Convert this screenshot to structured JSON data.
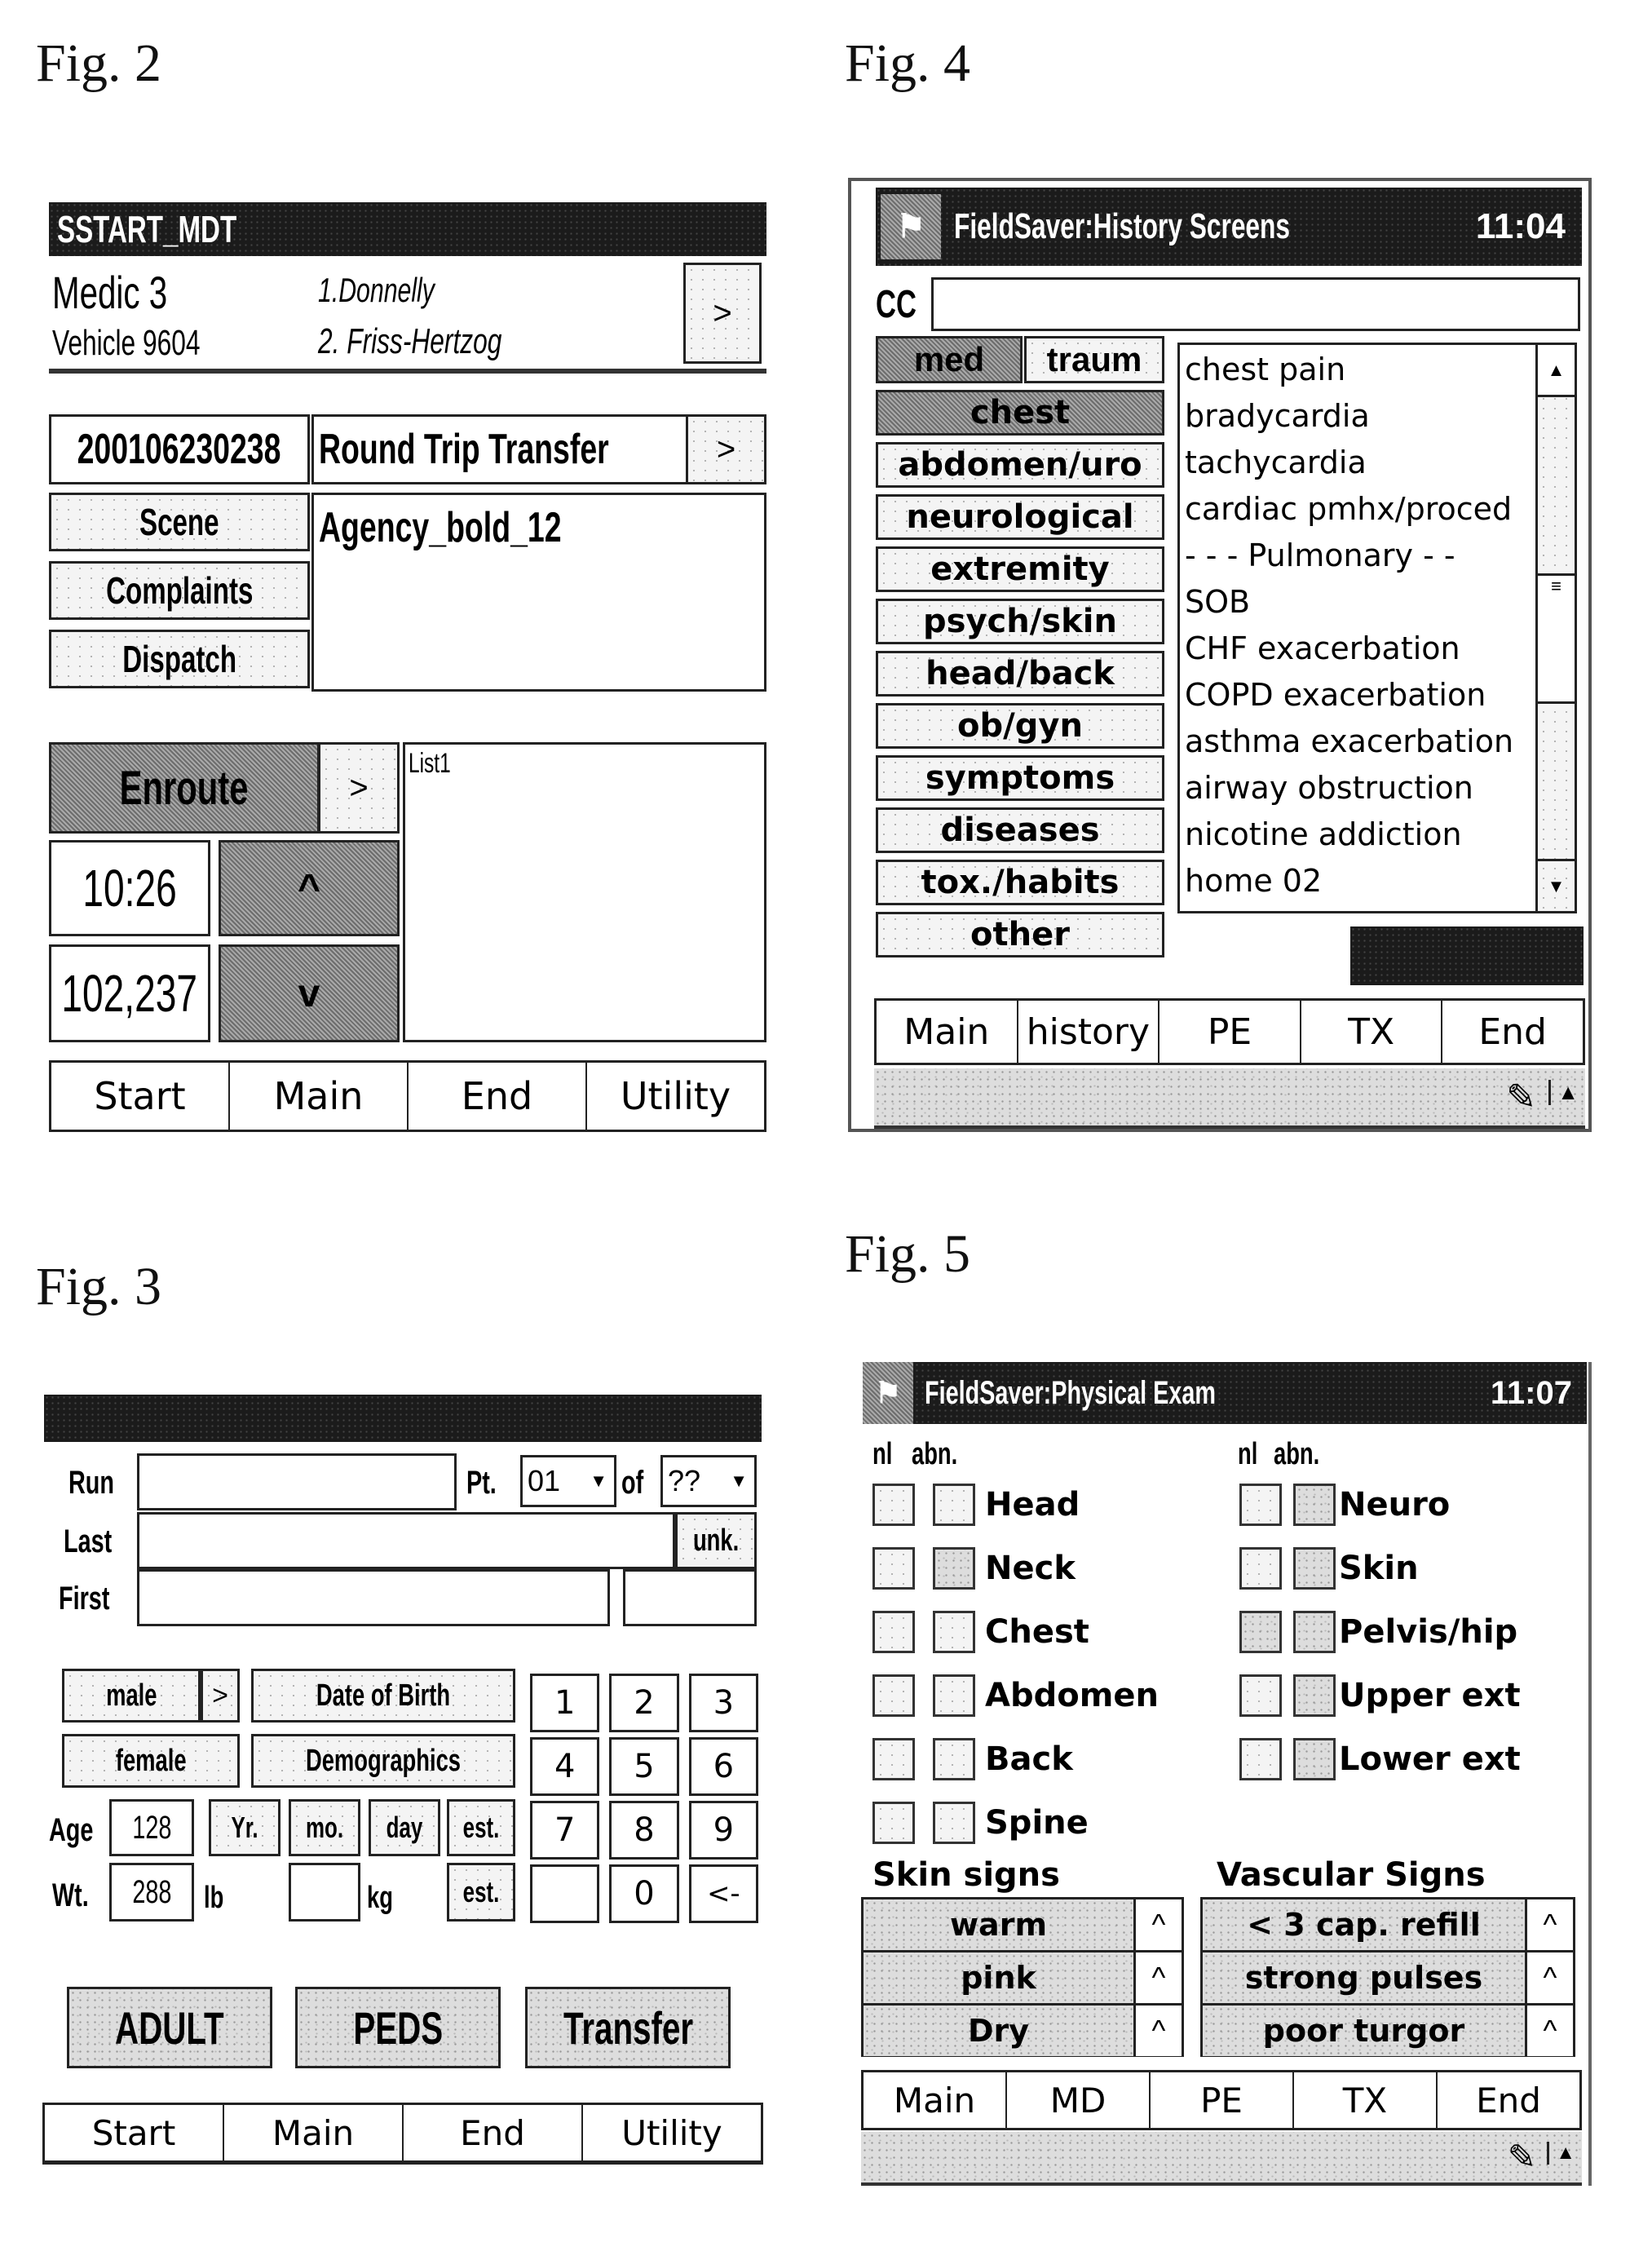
{
  "figures": {
    "fig2": {
      "label": "Fig. 2",
      "title": "SSTART_MDT",
      "unit": "Medic 3",
      "vehicle": "Vehicle 9604",
      "crew1": "1.Donnelly",
      "crew2": "2. Friss-Hertzog",
      "crew_next": ">",
      "run_number": "200106230238",
      "call_type": "Round Trip Transfer",
      "call_type_next": ">",
      "buttons": [
        "Scene",
        "Complaints",
        "Dispatch"
      ],
      "agency_text": "Agency_bold_12",
      "status_button": "Enroute",
      "status_next": ">",
      "time": "10:26",
      "odometer": "102,237",
      "up": "^",
      "down": "v",
      "list_label": "List1",
      "tabs": [
        "Start",
        "Main",
        "End",
        "Utility"
      ]
    },
    "fig3": {
      "label": "Fig. 3",
      "run_label": "Run",
      "run_value": "",
      "pt_label": "Pt.",
      "pt_value": "01",
      "of_label": "of",
      "of_value": "??",
      "last_label": "Last",
      "last_value": "",
      "unk_button": "unk.",
      "first_label": "First",
      "first_value": "",
      "male": "male",
      "male_next": ">",
      "female": "female",
      "dob": "Date of Birth",
      "demographics": "Demographics",
      "age_label": "Age",
      "age_value": "128",
      "age_units": [
        "Yr.",
        "mo.",
        "day",
        "est."
      ],
      "wt_label": "Wt.",
      "wt_value": "288",
      "lb": "lb",
      "kg_value": "",
      "kg": "kg",
      "wt_est": "est.",
      "keypad": [
        "1",
        "2",
        "3",
        "4",
        "5",
        "6",
        "7",
        "8",
        "9",
        "",
        "0",
        "<-"
      ],
      "category_buttons": [
        "ADULT",
        "PEDS",
        "Transfer"
      ],
      "tabs": [
        "Start",
        "Main",
        "End",
        "Utility"
      ]
    },
    "fig4": {
      "label": "Fig. 4",
      "title": "FieldSaver:History Screens",
      "clock": "11:04",
      "cc_label": "CC",
      "cc_value": "",
      "toggle": [
        "med",
        "traum"
      ],
      "categories": [
        "chest",
        "abdomen/uro",
        "neurological",
        "extremity",
        "psych/skin",
        "head/back",
        "ob/gyn",
        "symptoms",
        "diseases",
        "tox./habits",
        "other"
      ],
      "selected_category": "chest",
      "list_items": [
        "chest pain",
        "bradycardia",
        "tachycardia",
        "cardiac pmhx/proced",
        "- - - Pulmonary - -",
        "SOB",
        "CHF exacerbation",
        "COPD exacerbation",
        "asthma exacerbation",
        "airway obstruction",
        "nicotine addiction",
        "home 02"
      ],
      "tabs": [
        "Main",
        "history",
        "PE",
        "TX",
        "End"
      ]
    },
    "fig5": {
      "label": "Fig. 5",
      "title": "FieldSaver:Physical Exam",
      "clock": "11:07",
      "col_nl": "nl",
      "col_abn": "abn.",
      "left_items": [
        "Head",
        "Neck",
        "Chest",
        "Abdomen",
        "Back",
        "Spine"
      ],
      "right_items": [
        "Neuro",
        "Skin",
        "Pelvis/hip",
        "Upper ext",
        "Lower ext"
      ],
      "skin_title": "Skin signs",
      "skin_signs": [
        "warm",
        "pink",
        "Dry"
      ],
      "vascular_title": "Vascular Signs",
      "vascular_signs": [
        "< 3 cap. refill",
        "strong pulses",
        "poor turgor"
      ],
      "spinner": "^",
      "tabs": [
        "Main",
        "MD",
        "PE",
        "TX",
        "End"
      ]
    }
  }
}
